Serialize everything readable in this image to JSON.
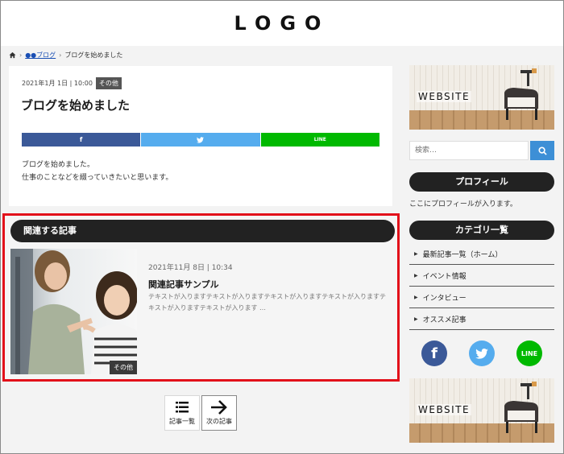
{
  "header": {
    "logo": "LOGO"
  },
  "breadcrumb": {
    "category": "●●ブログ",
    "current": "ブログを始めました",
    "separator": "›"
  },
  "article": {
    "date": "2021年1月 1日 | 10:00",
    "tag": "その他",
    "title": "ブログを始めました",
    "share": {
      "facebook": "f",
      "twitter": "t",
      "line": "LINE"
    },
    "body_line1": "ブログを始めました。",
    "body_line2": "仕事のことなどを綴っていきたいと思います。"
  },
  "related": {
    "heading": "関連する記事",
    "date": "2021年11月 8日 | 10:34",
    "title": "関連記事サンプル",
    "excerpt": "テキストが入りますテキストが入りますテキストが入りますテキストが入りますテキストが入りますテキストが入ります …",
    "tag": "その他"
  },
  "pager": {
    "list_label": "記事一覧",
    "next_label": "次の記事"
  },
  "sidebar": {
    "ad_label": "WEBSITE",
    "search_placeholder": "検索…",
    "profile_heading": "プロフィール",
    "profile_text": "ここにプロフィールが入ります。",
    "category_heading": "カテゴリ一覧",
    "categories": [
      "最新記事一覧（ホーム）",
      "イベント情報",
      "インタビュー",
      "オススメ記事"
    ],
    "social": {
      "facebook": "f",
      "line": "LINE"
    }
  },
  "colors": {
    "facebook": "#3b5998",
    "twitter": "#55acee",
    "line": "#00b900",
    "highlight": "#e2101a",
    "search_button": "#3d8fd6"
  }
}
